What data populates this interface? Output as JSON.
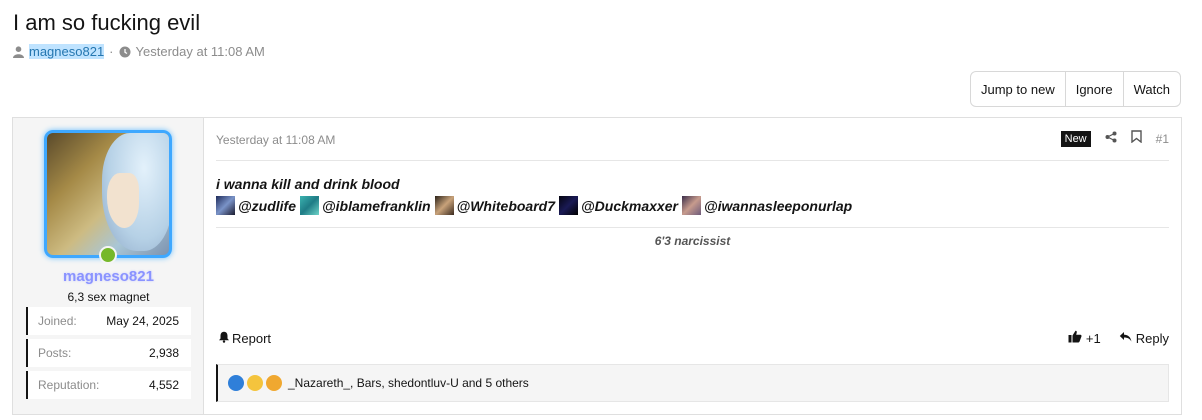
{
  "thread": {
    "title": "I am so fucking evil",
    "author": "magneso821",
    "separator": "·",
    "date": "Yesterday at 11:08 AM"
  },
  "thread_buttons": {
    "jump_to_new": "Jump to new",
    "ignore": "Ignore",
    "watch": "Watch"
  },
  "user": {
    "name": "magneso821",
    "title": "6,3 sex magnet",
    "stats": [
      {
        "label": "Joined:",
        "value": "May 24, 2025"
      },
      {
        "label": "Posts:",
        "value": "2,938"
      },
      {
        "label": "Reputation:",
        "value": "4,552"
      }
    ]
  },
  "post": {
    "date": "Yesterday at 11:08 AM",
    "badge": "New",
    "number": "#1",
    "line1": "i wanna kill and drink blood",
    "mentions": [
      "@zudlife",
      "@iblamefranklin",
      "@Whiteboard7",
      "@Duckmaxxer",
      "@iwannasleeponurlap"
    ],
    "signature": "6'3 narcissist",
    "report": "Report",
    "like_count": "+1",
    "reply": "Reply",
    "reactions_text": "_Nazareth_, Bars, shedontluv-U and 5 others"
  },
  "icons": {
    "user": "user-icon",
    "clock": "clock-icon",
    "share": "share-icon",
    "bookmark": "bookmark-icon",
    "bell": "bell-icon",
    "thumbs_up": "thumbs-up-icon",
    "reply": "reply-arrow-icon"
  },
  "colors": {
    "username": "#8a93ff",
    "avatar_border": "#3ea8ff",
    "online": "#76b82a",
    "author_highlight": "#bfe3ff"
  }
}
